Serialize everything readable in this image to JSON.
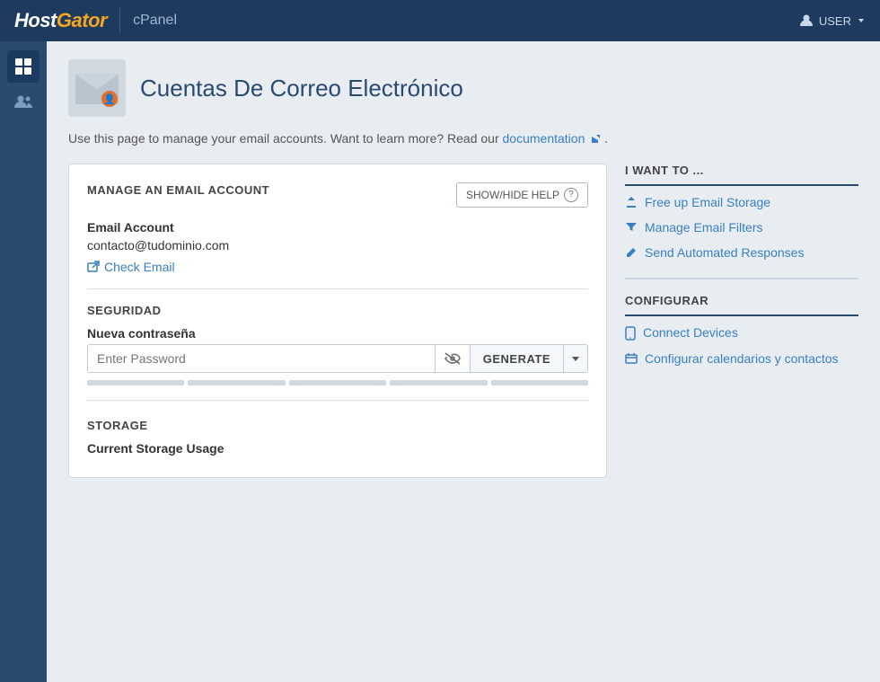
{
  "topnav": {
    "logo_host": "Host",
    "logo_gator": "Gator",
    "cpanel": "cPanel",
    "user_label": "USER"
  },
  "sidebar": {
    "icons": [
      {
        "name": "grid-icon",
        "glyph": "⊞",
        "active": true
      },
      {
        "name": "users-icon",
        "glyph": "👥",
        "active": false
      }
    ]
  },
  "page": {
    "title": "Cuentas De Correo Electrónico",
    "description": "Use this page to manage your email accounts. Want to learn more? Read our",
    "doc_link": "documentation",
    "show_hide_label": "SHOW/HIDE HELP"
  },
  "manage_section": {
    "title": "MANAGE AN EMAIL ACCOUNT",
    "email_account_label": "Email Account",
    "email_value": "contacto@tudominio.com",
    "check_email_label": "Check Email"
  },
  "seguridad_section": {
    "title": "SEGURIDAD",
    "password_label": "Nueva contraseña",
    "password_placeholder": "Enter Password",
    "generate_label": "GENERATE"
  },
  "storage_section": {
    "title": "STORAGE",
    "current_usage_label": "Current Storage Usage"
  },
  "i_want_to": {
    "title": "I WANT TO ...",
    "links": [
      {
        "id": "free-up-storage",
        "label": "Free up Email Storage",
        "icon": "upload-icon"
      },
      {
        "id": "manage-filters",
        "label": "Manage Email Filters",
        "icon": "filter-icon"
      },
      {
        "id": "send-automated",
        "label": "Send Automated Responses",
        "icon": "pencil-icon"
      }
    ]
  },
  "configurar": {
    "title": "CONFIGURAR",
    "links": [
      {
        "id": "connect-devices",
        "label": "Connect Devices",
        "icon": "mobile-icon"
      },
      {
        "id": "configurar-calendarios",
        "label": "Configurar calendarios y contactos",
        "icon": "card-icon"
      }
    ]
  }
}
